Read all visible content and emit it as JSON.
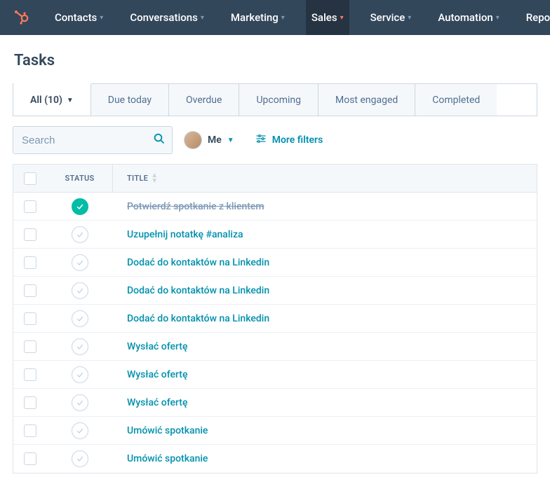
{
  "nav": {
    "items": [
      {
        "label": "Contacts",
        "active": false
      },
      {
        "label": "Conversations",
        "active": false
      },
      {
        "label": "Marketing",
        "active": false
      },
      {
        "label": "Sales",
        "active": true
      },
      {
        "label": "Service",
        "active": false
      },
      {
        "label": "Automation",
        "active": false
      },
      {
        "label": "Reports",
        "active": false
      }
    ]
  },
  "page": {
    "title": "Tasks"
  },
  "tabs": [
    {
      "label": "All (10)",
      "active": true,
      "hasDropdown": true
    },
    {
      "label": "Due today",
      "active": false,
      "hasDropdown": false
    },
    {
      "label": "Overdue",
      "active": false,
      "hasDropdown": false
    },
    {
      "label": "Upcoming",
      "active": false,
      "hasDropdown": false
    },
    {
      "label": "Most engaged",
      "active": false,
      "hasDropdown": false
    },
    {
      "label": "Completed",
      "active": false,
      "hasDropdown": false
    }
  ],
  "filters": {
    "search_placeholder": "Search",
    "me_label": "Me",
    "more_filters_label": "More filters"
  },
  "table": {
    "columns": {
      "status": "STATUS",
      "title": "TITLE"
    },
    "rows": [
      {
        "done": true,
        "title": "Potwierdź spotkanie z klientem"
      },
      {
        "done": false,
        "title": "Uzupełnij notatkę #analiza"
      },
      {
        "done": false,
        "title": "Dodać do kontaktów na Linkedin"
      },
      {
        "done": false,
        "title": "Dodać do kontaktów na Linkedin"
      },
      {
        "done": false,
        "title": "Dodać do kontaktów na Linkedin"
      },
      {
        "done": false,
        "title": "Wysłać ofertę"
      },
      {
        "done": false,
        "title": "Wysłać ofertę"
      },
      {
        "done": false,
        "title": "Wysłać ofertę"
      },
      {
        "done": false,
        "title": "Umówić spotkanie"
      },
      {
        "done": false,
        "title": "Umówić spotkanie"
      }
    ]
  }
}
